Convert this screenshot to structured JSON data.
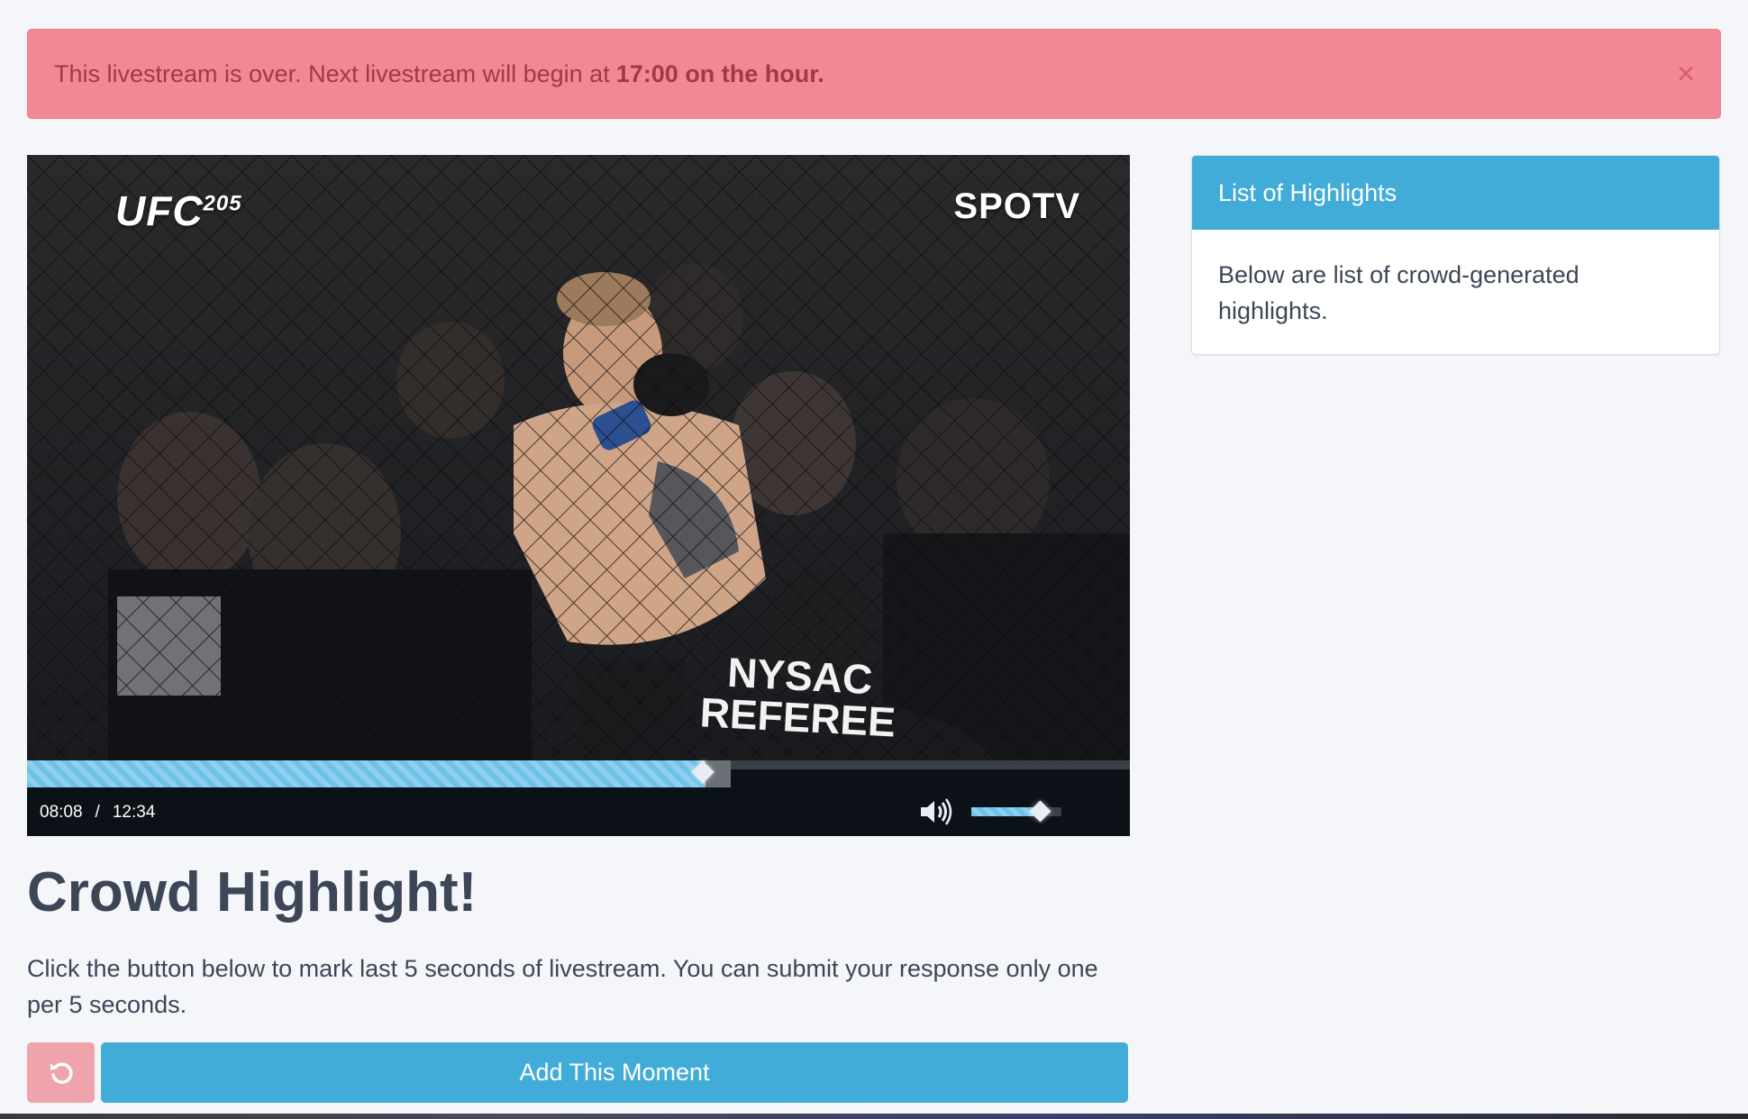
{
  "alert": {
    "message": "This livestream is over. Next livestream will begin at",
    "emphasis": "17:00 on the hour.",
    "close_glyph": "×"
  },
  "video": {
    "overlay_left": "UFC",
    "overlay_left_sup": "205",
    "overlay_right": "SPOTV",
    "referee_text_1": "NYSAC",
    "referee_text_2": "REFEREE",
    "current_time": "08:08",
    "separator": "/",
    "duration": "12:34",
    "progress_fraction": 0.64,
    "volume_fraction": 0.76
  },
  "highlight": {
    "title": "Crowd Highlight!",
    "description": "Click the button below to mark last 5 seconds of livestream. You can submit your response only one per 5 seconds.",
    "add_button": "Add This Moment"
  },
  "panel": {
    "title": "List of Highlights",
    "body": "Below are list of crowd-generated highlights."
  },
  "colors": {
    "alert_bg": "#f28893",
    "primary": "#42acd8",
    "reset_bg": "#efa4ab",
    "page_bg": "#f4f6fa"
  }
}
